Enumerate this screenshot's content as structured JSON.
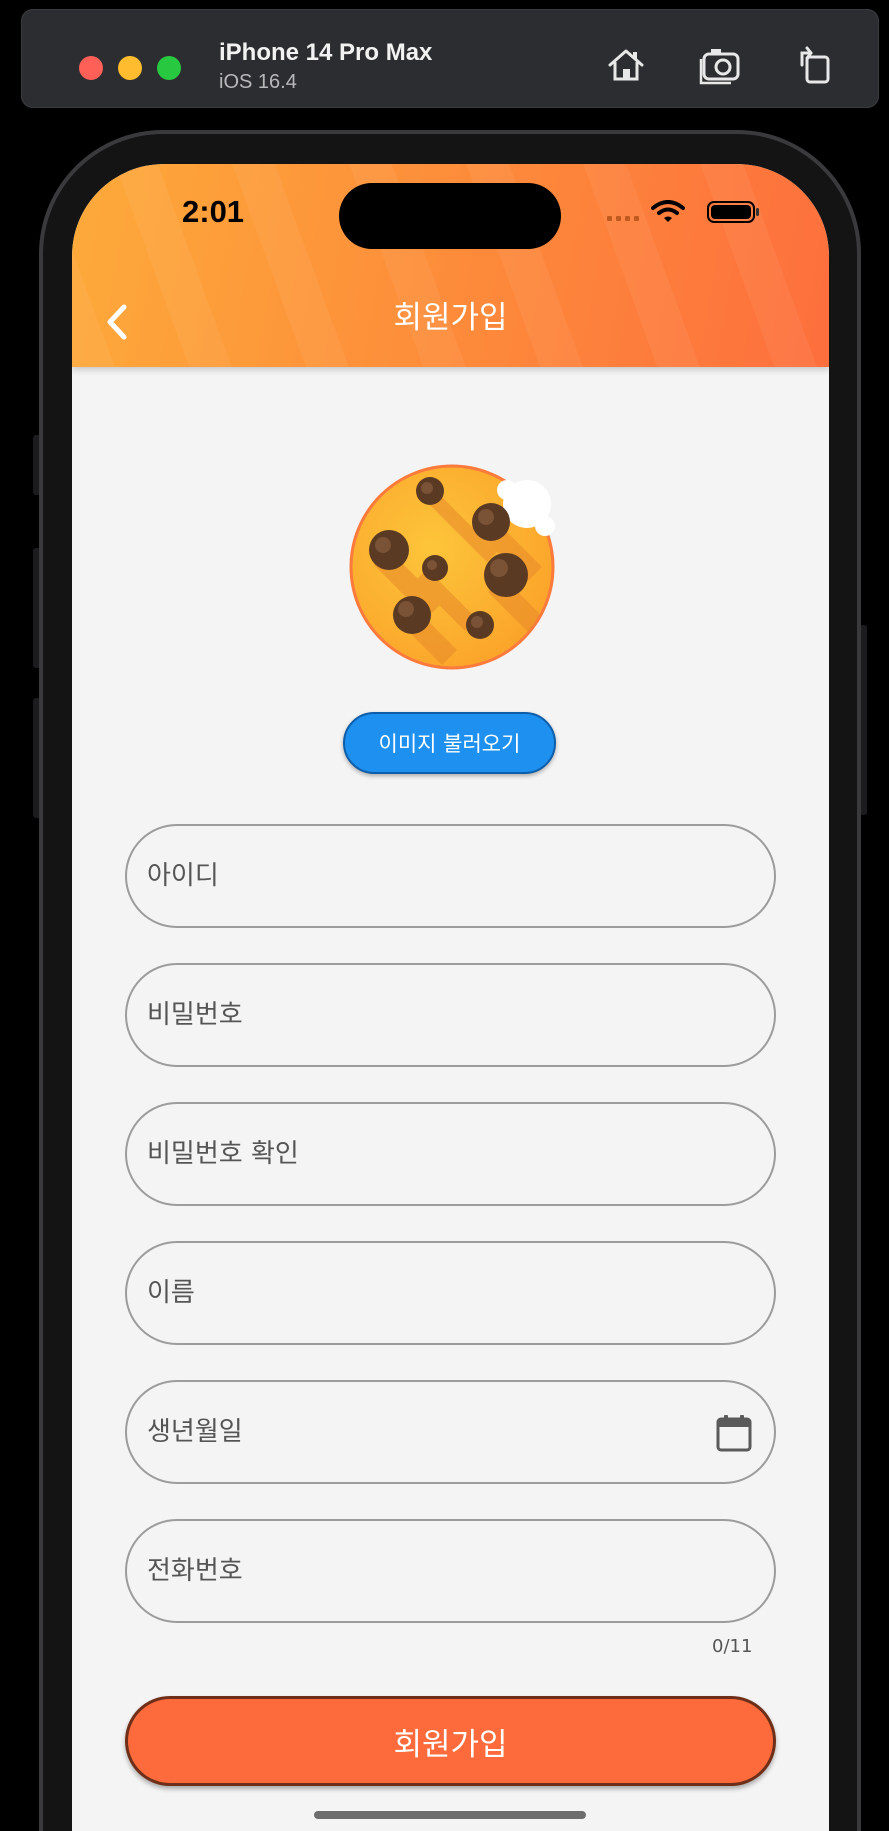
{
  "simulator": {
    "device": "iPhone 14 Pro Max",
    "os": "iOS 16.4",
    "icons": [
      "home-icon",
      "screenshot-icon",
      "rotate-icon"
    ]
  },
  "status_bar": {
    "time": "2:01"
  },
  "app_bar": {
    "title": "회원가입",
    "back_icon": "chevron-left-icon"
  },
  "profile": {
    "image": "cookie-avatar",
    "load_button": "이미지 불러오기"
  },
  "form": {
    "id_placeholder": "아이디",
    "password_placeholder": "비밀번호",
    "password_confirm_placeholder": "비밀번호 확인",
    "name_placeholder": "이름",
    "birth_placeholder": "생년월일",
    "birth_icon": "calendar-icon",
    "phone_placeholder": "전화번호",
    "phone_counter": "0/11",
    "submit_label": "회원가입"
  },
  "colors": {
    "header_start": "#fdaa3a",
    "header_end": "#fd6f3d",
    "load_button": "#1e90f0",
    "submit_button": "#fd6b3d",
    "background": "#f4f4f4"
  }
}
